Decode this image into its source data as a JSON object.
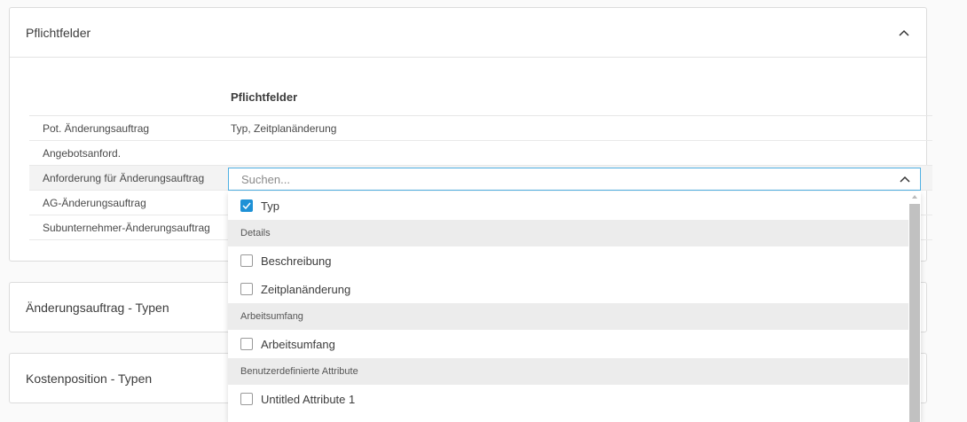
{
  "sections": [
    {
      "title": "Pflichtfelder",
      "expanded": true
    },
    {
      "title": "Änderungsauftrag - Typen",
      "expanded": false
    },
    {
      "title": "Kostenposition - Typen",
      "expanded": false
    }
  ],
  "table": {
    "header": "Pflichtfelder",
    "rows": [
      {
        "name": "Pot. Änderungsauftrag",
        "value": "Typ, Zeitplanänderung"
      },
      {
        "name": "Angebotsanford.",
        "value": ""
      },
      {
        "name": "Anforderung für Änderungsauftrag",
        "value": ""
      },
      {
        "name": "AG-Änderungsauftrag",
        "value": ""
      },
      {
        "name": "Subunternehmer-Änderungsauftrag",
        "value": ""
      }
    ]
  },
  "dropdown": {
    "placeholder": "Suchen...",
    "items": [
      {
        "type": "option",
        "label": "Typ",
        "checked": true
      },
      {
        "type": "group",
        "label": "Details"
      },
      {
        "type": "option",
        "label": "Beschreibung",
        "checked": false
      },
      {
        "type": "option",
        "label": "Zeitplanänderung",
        "checked": false
      },
      {
        "type": "group",
        "label": "Arbeitsumfang"
      },
      {
        "type": "option",
        "label": "Arbeitsumfang",
        "checked": false
      },
      {
        "type": "group",
        "label": "Benutzerdefinierte Attribute"
      },
      {
        "type": "option",
        "label": "Untitled Attribute 1",
        "checked": false
      }
    ]
  }
}
